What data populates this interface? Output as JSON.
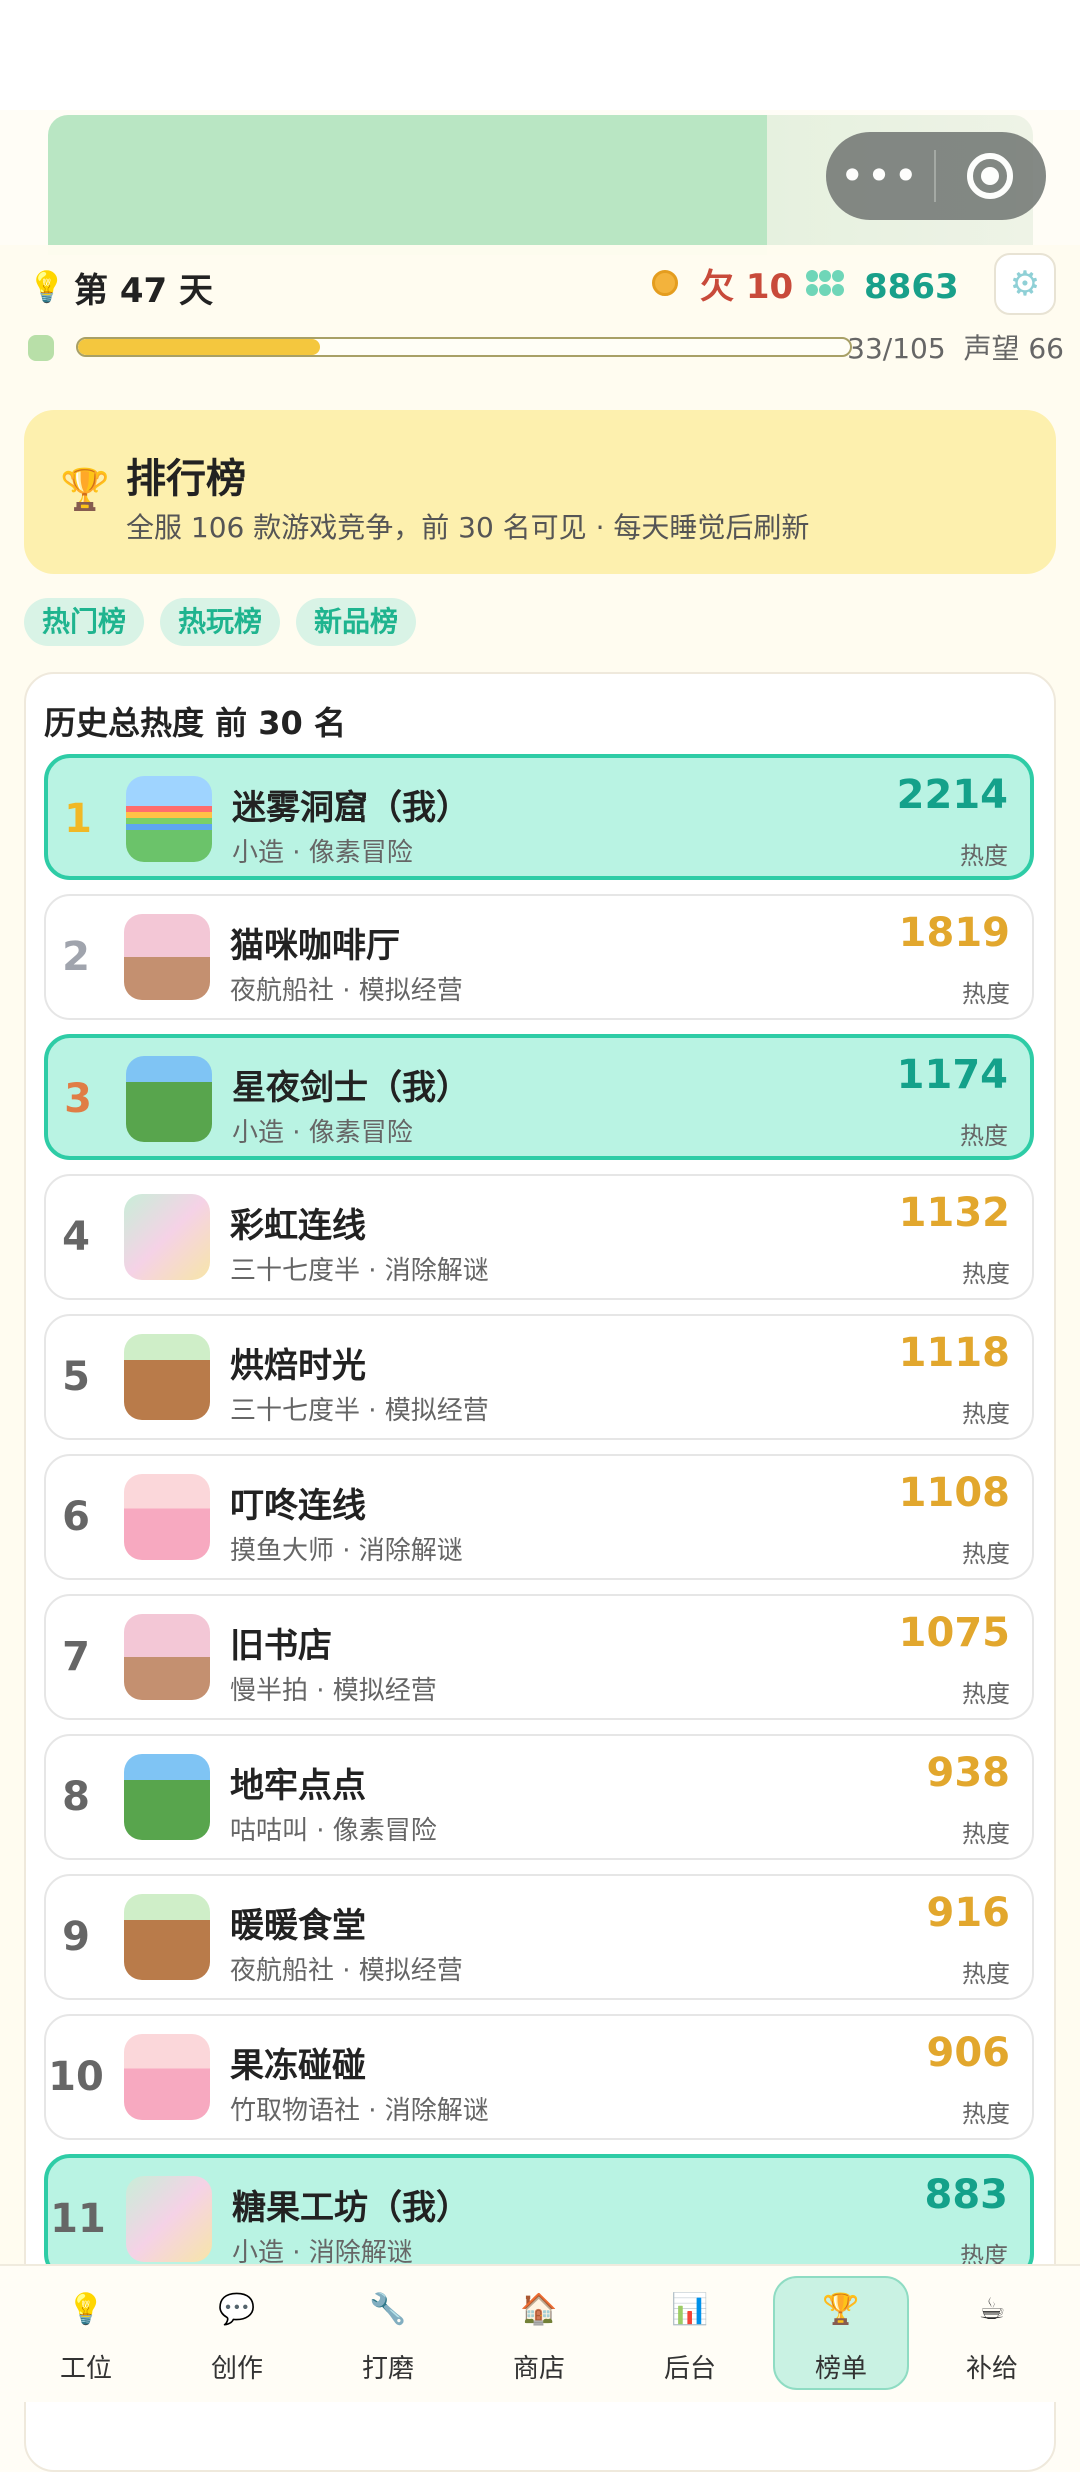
{
  "header": {
    "day_label": "第 47 天",
    "debt_label": "欠 10",
    "gems": "8863",
    "progress_text": "33/105",
    "progress_fraction": 0.314,
    "reputation": "声望 66"
  },
  "leaderboard": {
    "title": "排行榜",
    "subtitle": "全服 106 款游戏竞争，前 30 名可见 · 每天睡觉后刷新"
  },
  "tabs": [
    "热门榜",
    "热玩榜",
    "新品榜"
  ],
  "list_title": "历史总热度 前 30 名",
  "heat_label": "热度",
  "rows": [
    {
      "rank": "1",
      "name": "迷雾洞窟（我）",
      "sub": "小造 · 像素冒险",
      "heat": "2214"
    },
    {
      "rank": "2",
      "name": "猫咪咖啡厅",
      "sub": "夜航船社 · 模拟经营",
      "heat": "1819"
    },
    {
      "rank": "3",
      "name": "星夜剑士（我）",
      "sub": "小造 · 像素冒险",
      "heat": "1174"
    },
    {
      "rank": "4",
      "name": "彩虹连线",
      "sub": "三十七度半 · 消除解谜",
      "heat": "1132"
    },
    {
      "rank": "5",
      "name": "烘焙时光",
      "sub": "三十七度半 · 模拟经营",
      "heat": "1118"
    },
    {
      "rank": "6",
      "name": "叮咚连线",
      "sub": "摸鱼大师 · 消除解谜",
      "heat": "1108"
    },
    {
      "rank": "7",
      "name": "旧书店",
      "sub": "慢半拍 · 模拟经营",
      "heat": "1075"
    },
    {
      "rank": "8",
      "name": "地牢点点",
      "sub": "咕咕叫 · 像素冒险",
      "heat": "938"
    },
    {
      "rank": "9",
      "name": "暖暖食堂",
      "sub": "夜航船社 · 模拟经营",
      "heat": "916"
    },
    {
      "rank": "10",
      "name": "果冻碰碰",
      "sub": "竹取物语社 · 消除解谜",
      "heat": "906"
    },
    {
      "rank": "11",
      "name": "糖果工坊（我）",
      "sub": "小造 · 消除解谜",
      "heat": "883"
    }
  ],
  "nav": [
    "工位",
    "创作",
    "打磨",
    "商店",
    "后台",
    "榜单",
    "补给"
  ],
  "colors": {
    "accent": "#2ecca6",
    "heat": "#e2a72d",
    "debt": "#c84a3a"
  }
}
